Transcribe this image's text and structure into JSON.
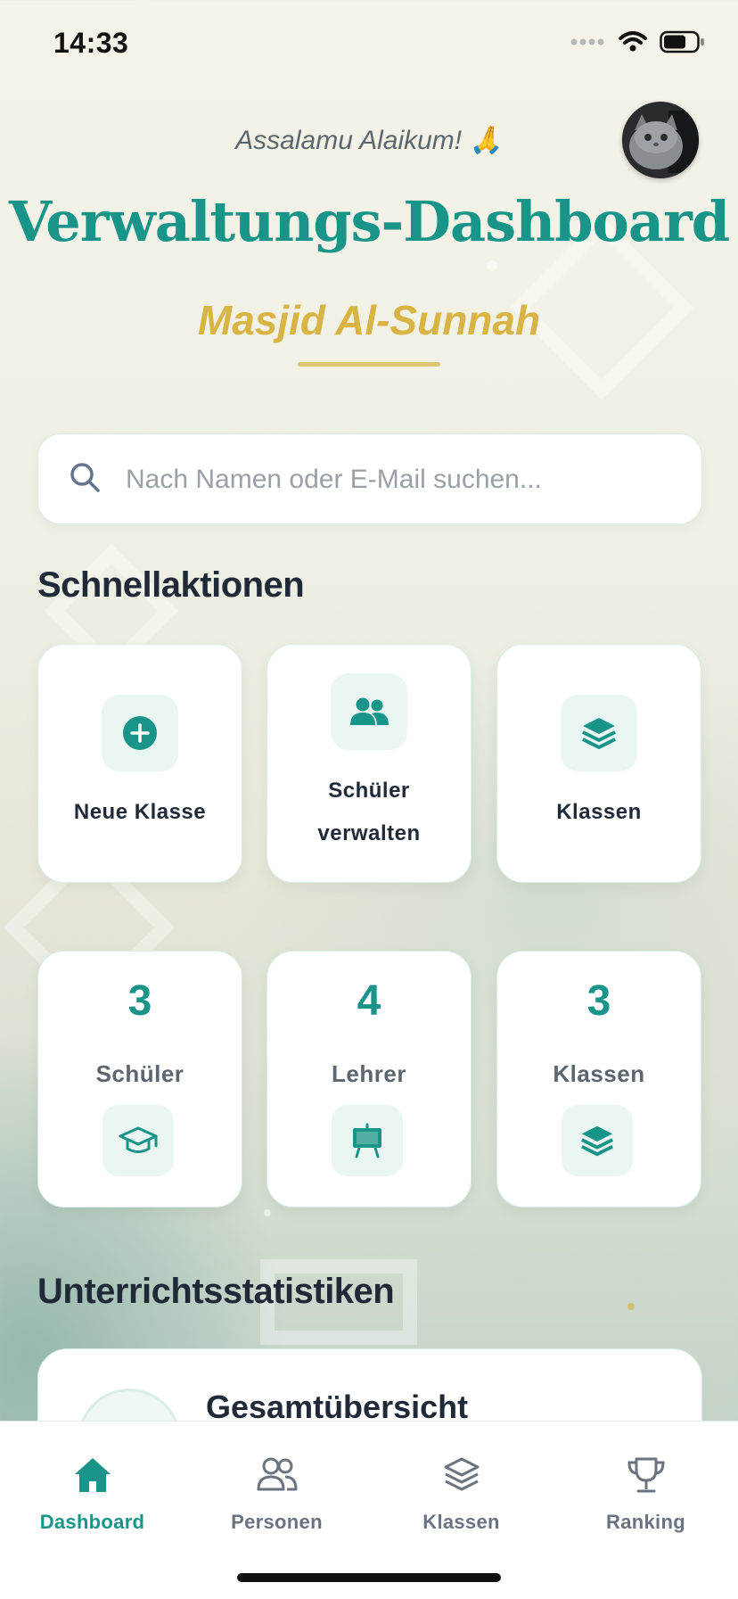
{
  "status_bar": {
    "time": "14:33"
  },
  "header": {
    "greeting": "Assalamu Alaikum! 🙏",
    "title": "Verwaltungs-Dashboard",
    "subtitle": "Masjid Al-Sunnah"
  },
  "search": {
    "placeholder": "Nach Namen oder E-Mail suchen...",
    "value": ""
  },
  "quick_actions": {
    "title": "Schnellaktionen",
    "items": [
      {
        "label": "Neue Klasse",
        "icon": "plus-circle-icon"
      },
      {
        "label_line1": "Schüler",
        "label_line2": "verwalten",
        "icon": "users-icon"
      },
      {
        "label": "Klassen",
        "icon": "layers-icon"
      }
    ]
  },
  "stats": [
    {
      "value": "3",
      "label": "Schüler",
      "icon": "graduation-cap-icon"
    },
    {
      "value": "4",
      "label": "Lehrer",
      "icon": "chalkboard-icon"
    },
    {
      "value": "3",
      "label": "Klassen",
      "icon": "layers-icon"
    }
  ],
  "teaching_stats": {
    "title": "Unterrichtsstatistiken",
    "overview_title": "Gesamtübersicht"
  },
  "bottom_nav": {
    "items": [
      {
        "label": "Dashboard",
        "icon": "home-icon",
        "active": true
      },
      {
        "label": "Personen",
        "icon": "people-icon",
        "active": false
      },
      {
        "label": "Klassen",
        "icon": "layers-icon",
        "active": false
      },
      {
        "label": "Ranking",
        "icon": "trophy-icon",
        "active": false
      }
    ]
  },
  "colors": {
    "primary": "#199488",
    "accent": "#d8b444",
    "text_dark": "#1f2937",
    "muted": "#6b7280"
  }
}
